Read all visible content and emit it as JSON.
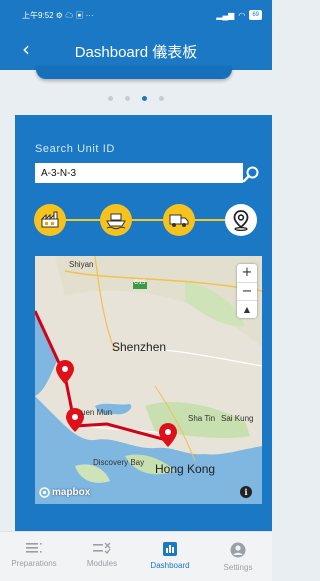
{
  "status_bar": {
    "time": "上午9:52",
    "extra": "···",
    "battery": "69"
  },
  "header": {
    "back_icon": "back-arrow-icon",
    "title": "Dashboard 儀表板"
  },
  "carousel": {
    "page_count": 4,
    "active_index": 2
  },
  "search": {
    "label": "Search Unit ID",
    "value": "A-3-N-3",
    "button_icon": "search-icon"
  },
  "progress": {
    "steps": [
      {
        "icon": "factory-icon",
        "state": "completed"
      },
      {
        "icon": "ship-icon",
        "state": "completed"
      },
      {
        "icon": "truck-icon",
        "state": "completed"
      },
      {
        "icon": "location-pin-icon",
        "state": "current"
      }
    ],
    "colors": {
      "completed": "#f5c21e",
      "current": "#ffffff",
      "track": "#f5c928"
    }
  },
  "map": {
    "labels": {
      "shiyan": "Shiyan",
      "road": "G15",
      "shenzhen": "Shenzhen",
      "tuen_mun": "uen Mun",
      "sha_tin": "Sha Tin",
      "sai_kung": "Sai Kung",
      "discovery_bay": "Discovery Bay",
      "hong_kong": "Hong Kong"
    },
    "zoom_in": "+",
    "zoom_out": "−",
    "compass": "▲",
    "attribution": "mapbox",
    "info": "i",
    "route_color": "#d0021b"
  },
  "nav": {
    "items": [
      {
        "label": "Preparations",
        "icon": "list-icon"
      },
      {
        "label": "Modules",
        "icon": "checklist-icon"
      },
      {
        "label": "Dashboard",
        "icon": "bar-chart-icon"
      },
      {
        "label": "Settings",
        "icon": "user-icon"
      }
    ],
    "active_index": 2,
    "colors": {
      "active": "#1a78c5",
      "inactive": "#9aa0a6"
    }
  }
}
